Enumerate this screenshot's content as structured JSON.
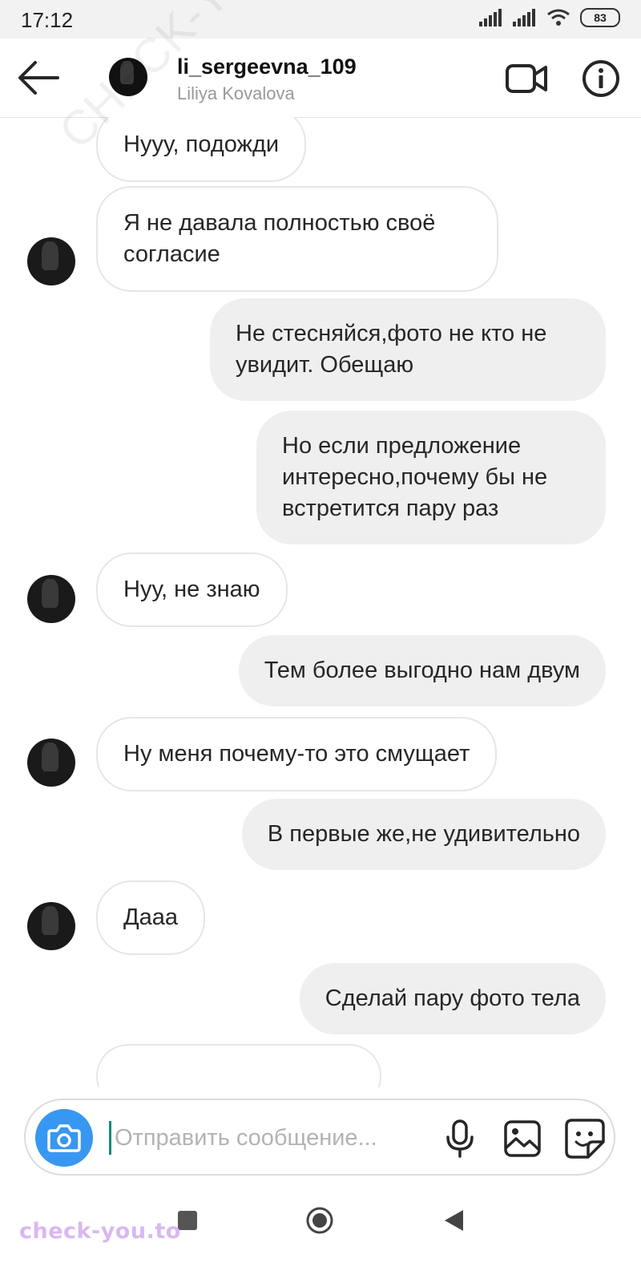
{
  "status": {
    "time": "17:12",
    "battery": "83"
  },
  "header": {
    "username": "li_sergeevna_109",
    "fullname": "Liliya Kovalova"
  },
  "messages": [
    {
      "dir": "in",
      "text": "Нууу, подожди"
    },
    {
      "dir": "in",
      "text": "Я не давала полностью своё согласие"
    },
    {
      "dir": "out",
      "text": "Не стесняйся,фото не кто не увидит. Обещаю"
    },
    {
      "dir": "out",
      "text": "Но если предложение интересно,почему бы не встретится пару раз"
    },
    {
      "dir": "in",
      "text": "Нуу, не знаю"
    },
    {
      "dir": "out",
      "text": "Тем более выгодно нам двум"
    },
    {
      "dir": "in",
      "text": "Ну меня почему-то это смущает"
    },
    {
      "dir": "out",
      "text": "В первые же,не удивительно"
    },
    {
      "dir": "in",
      "text": "Дааа"
    },
    {
      "dir": "out",
      "text": "Сделай пару фото тела"
    }
  ],
  "composer": {
    "placeholder": "Отправить сообщение..."
  },
  "brand": {
    "text": "check-you.to"
  },
  "watermark": {
    "text": "CHECK-YOU.ME"
  },
  "colors": {
    "camera": "#3897f0",
    "incoming_bg": "#ffffff",
    "outgoing_bg": "#efefef"
  }
}
